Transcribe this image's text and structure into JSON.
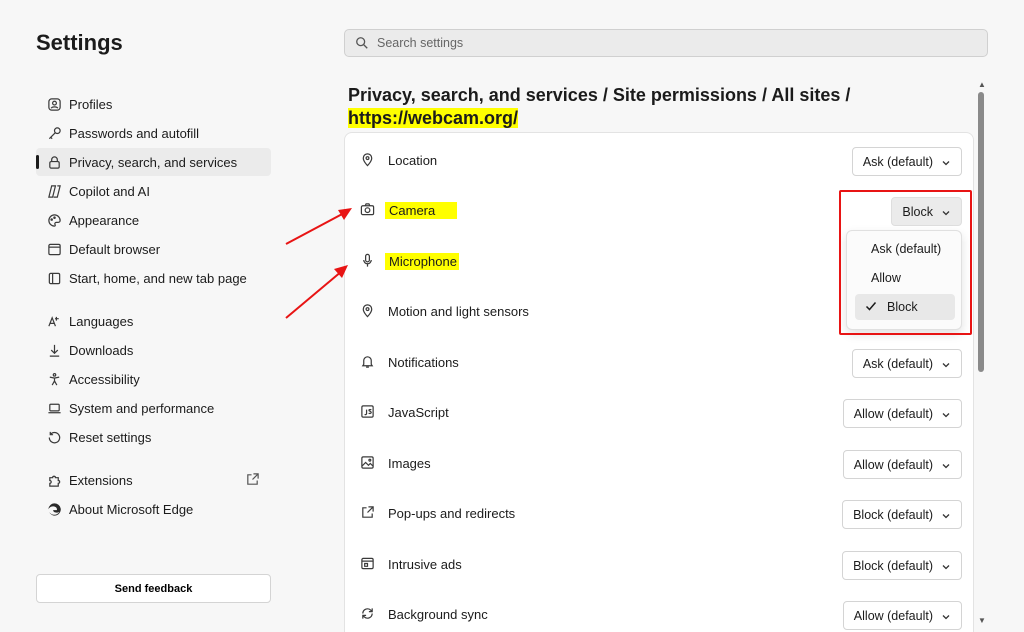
{
  "sidebar": {
    "title": "Settings",
    "items": [
      {
        "label": "Profiles",
        "icon": "profile-icon"
      },
      {
        "label": "Passwords and autofill",
        "icon": "key-icon"
      },
      {
        "label": "Privacy, search, and services",
        "icon": "lock-icon",
        "active": true
      },
      {
        "label": "Copilot and AI",
        "icon": "copilot-icon"
      },
      {
        "label": "Appearance",
        "icon": "palette-icon"
      },
      {
        "label": "Default browser",
        "icon": "browser-icon"
      },
      {
        "label": "Start, home, and new tab page",
        "icon": "home-icon"
      },
      {
        "label": "Languages",
        "icon": "language-icon"
      },
      {
        "label": "Downloads",
        "icon": "download-icon"
      },
      {
        "label": "Accessibility",
        "icon": "accessibility-icon"
      },
      {
        "label": "System and performance",
        "icon": "laptop-icon"
      },
      {
        "label": "Reset settings",
        "icon": "reset-icon"
      },
      {
        "label": "Extensions",
        "icon": "puzzle-icon"
      },
      {
        "label": "About Microsoft Edge",
        "icon": "edge-icon"
      }
    ],
    "feedback_label": "Send feedback"
  },
  "search": {
    "placeholder": "Search settings"
  },
  "breadcrumb": {
    "part1": "Privacy, search, and services",
    "sep": "/",
    "part2": "Site permissions",
    "part3": "All sites",
    "site": "https://webcam.org/"
  },
  "permissions": [
    {
      "label": "Location",
      "value": "Ask (default)",
      "icon": "location-icon"
    },
    {
      "label": "Camera",
      "value": "Block",
      "icon": "camera-icon",
      "highlighted": true
    },
    {
      "label": "Microphone",
      "value": "",
      "icon": "microphone-icon",
      "highlighted": true
    },
    {
      "label": "Motion and light sensors",
      "value": "",
      "icon": "sensor-icon"
    },
    {
      "label": "Notifications",
      "value": "Ask (default)",
      "icon": "bell-icon"
    },
    {
      "label": "JavaScript",
      "value": "Allow (default)",
      "icon": "javascript-icon"
    },
    {
      "label": "Images",
      "value": "Allow (default)",
      "icon": "image-icon"
    },
    {
      "label": "Pop-ups and redirects",
      "value": "Block (default)",
      "icon": "popup-icon"
    },
    {
      "label": "Intrusive ads",
      "value": "Block (default)",
      "icon": "ads-icon"
    },
    {
      "label": "Background sync",
      "value": "Allow (default)",
      "icon": "sync-icon"
    }
  ],
  "dropdown": {
    "options": [
      "Ask (default)",
      "Allow",
      "Block"
    ],
    "selected": "Block"
  },
  "colors": {
    "highlight": "#ffff00",
    "annotation": "#e81414"
  }
}
